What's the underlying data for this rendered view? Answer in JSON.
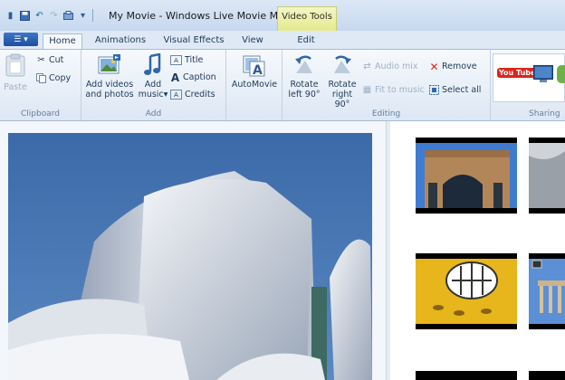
{
  "window": {
    "title": "My Movie - Windows Live Movie Maker",
    "context_tab": "Video Tools"
  },
  "tabs": [
    {
      "label": "Home",
      "active": true
    },
    {
      "label": "Animations",
      "active": false
    },
    {
      "label": "Visual Effects",
      "active": false
    },
    {
      "label": "View",
      "active": false
    },
    {
      "label": "Edit",
      "active": false
    }
  ],
  "ribbon": {
    "clipboard": {
      "label": "Clipboard",
      "paste": "Paste",
      "cut": "Cut",
      "copy": "Copy"
    },
    "add": {
      "label": "Add",
      "add_videos_line1": "Add videos",
      "add_videos_line2": "and photos",
      "add_music_line1": "Add",
      "add_music_line2": "music",
      "title": "Title",
      "caption": "Caption",
      "credits": "Credits"
    },
    "automovie": {
      "label": "AutoMovie"
    },
    "editing": {
      "label": "Editing",
      "rotate_left_line1": "Rotate",
      "rotate_left_line2": "left 90°",
      "rotate_right_line1": "Rotate",
      "rotate_right_line2": "right 90°",
      "audio_mix": "Audio mix",
      "fit_to_music": "Fit to music",
      "remove": "Remove",
      "select_all": "Select all"
    },
    "sharing": {
      "label": "Sharing",
      "youtube": "You Tube"
    }
  },
  "colors": {
    "accent": "#2f5b9a",
    "context_tab": "#e4ea8d",
    "remove_red": "#d9261c"
  }
}
